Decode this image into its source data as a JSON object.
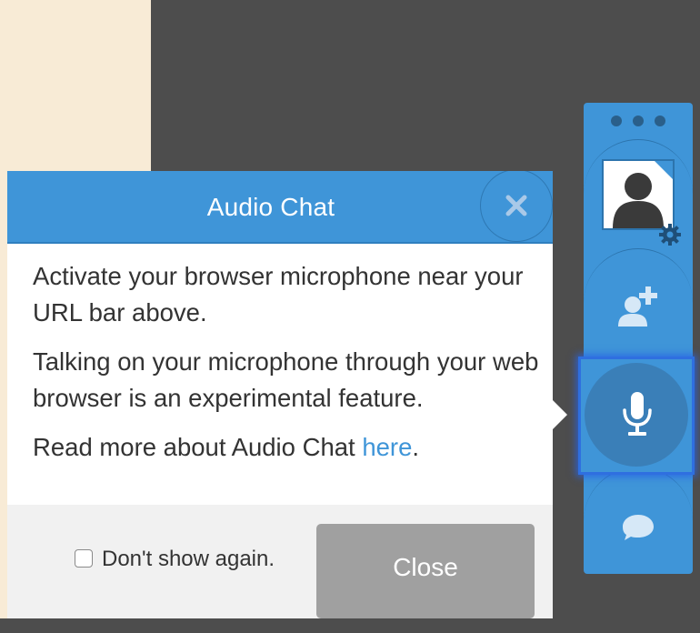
{
  "dialog": {
    "title": "Audio Chat",
    "paragraph1": "Activate your browser microphone near your URL bar above.",
    "paragraph2": "Talking on your microphone through your web browser is an experimental feature.",
    "paragraph3_prefix": "Read more about Audio Chat ",
    "paragraph3_link": "here",
    "paragraph3_suffix": ".",
    "dont_show_label": "Don't show again.",
    "close_label": "Close"
  },
  "toolbar": {
    "icons": [
      "more-dots-icon",
      "avatar-icon",
      "settings-gear-icon",
      "add-user-icon",
      "microphone-icon",
      "chat-bubble-icon"
    ]
  },
  "colors": {
    "accent": "#3f95d8",
    "active_highlight": "#2f6fe0",
    "button_disabled": "#a0a0a0",
    "page_left_bg": "#f8ebd6",
    "page_bg": "#4d4d4d"
  }
}
